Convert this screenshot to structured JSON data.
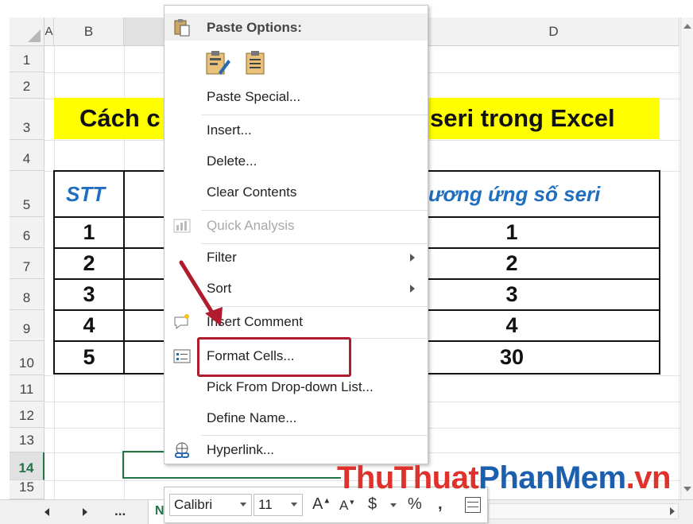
{
  "columns": {
    "a": "A",
    "b": "B",
    "d": "D"
  },
  "rows": [
    "1",
    "2",
    "3",
    "4",
    "5",
    "6",
    "7",
    "8",
    "9",
    "10",
    "11",
    "12",
    "13",
    "14",
    "15"
  ],
  "title": {
    "left": "Cách c",
    "right": "seri trong Excel"
  },
  "table": {
    "header_left": "STT",
    "header_right": "ương ứng số seri",
    "stt": [
      "1",
      "2",
      "3",
      "4",
      "5"
    ],
    "serial": [
      "1",
      "2",
      "3",
      "4",
      "30"
    ]
  },
  "menu": {
    "paste_options": "Paste Options:",
    "items": [
      {
        "label": "Paste Special...",
        "enabled": true
      },
      {
        "label": "Insert...",
        "enabled": true
      },
      {
        "label": "Delete...",
        "enabled": true
      },
      {
        "label": "Clear Contents",
        "enabled": true
      },
      {
        "label": "Quick Analysis",
        "enabled": false
      },
      {
        "label": "Filter",
        "enabled": true
      },
      {
        "label": "Sort",
        "enabled": true
      },
      {
        "label": "Insert Comment",
        "enabled": true
      },
      {
        "label": "Format Cells...",
        "enabled": true
      },
      {
        "label": "Pick From Drop-down List...",
        "enabled": true
      },
      {
        "label": "Define Name...",
        "enabled": true
      },
      {
        "label": "Hyperlink...",
        "enabled": true
      }
    ]
  },
  "toolbar": {
    "font": "Calibri",
    "size": "11",
    "currency": "$",
    "percent": "%",
    "comma": ","
  },
  "tabs": {
    "ellipsis": "..."
  },
  "watermark": {
    "part1": "ThuThuat",
    "part2": "PhanMem",
    "part3": ".vn"
  },
  "colors": {
    "highlight": "#ffff00",
    "header_blue": "#1f6ec0",
    "callout": "#b01c2e",
    "excel_green": "#217346"
  }
}
